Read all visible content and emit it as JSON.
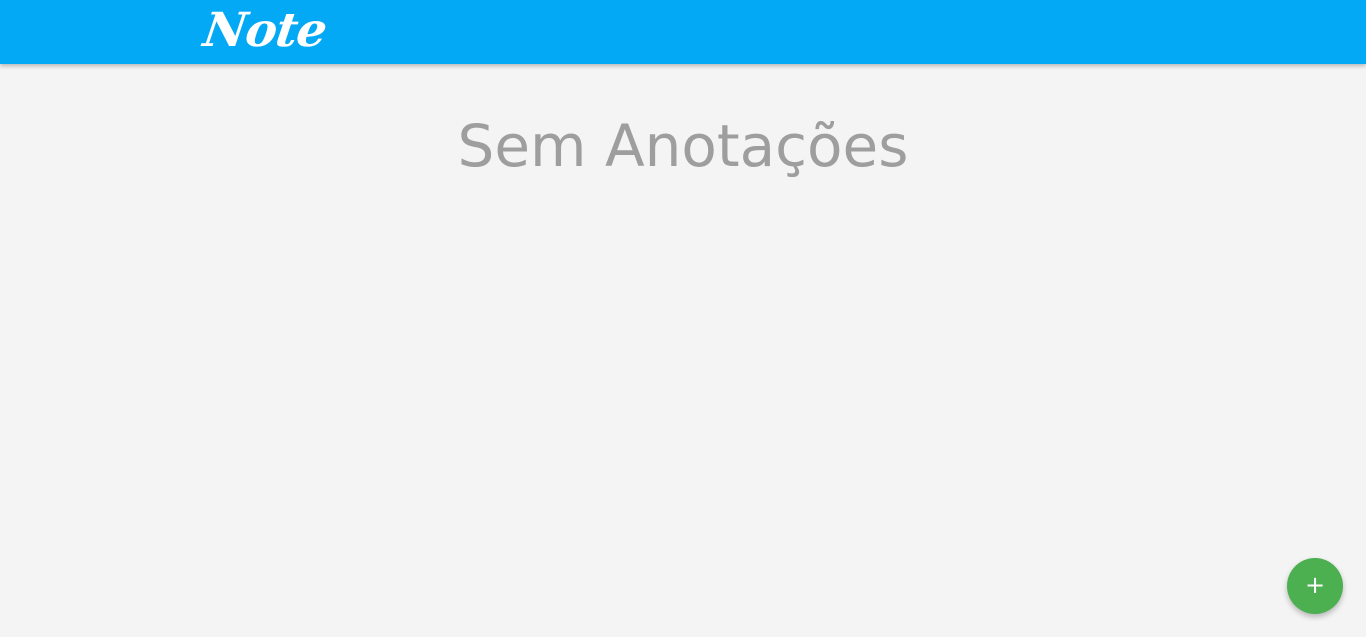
{
  "header": {
    "logo_text": "Note",
    "background_color": "#03a9f4"
  },
  "main": {
    "empty_message": "Sem Anotações",
    "background_color": "#f4f4f4"
  },
  "fab": {
    "icon": "plus-icon",
    "glyph": "+",
    "color": "#4caf50"
  }
}
